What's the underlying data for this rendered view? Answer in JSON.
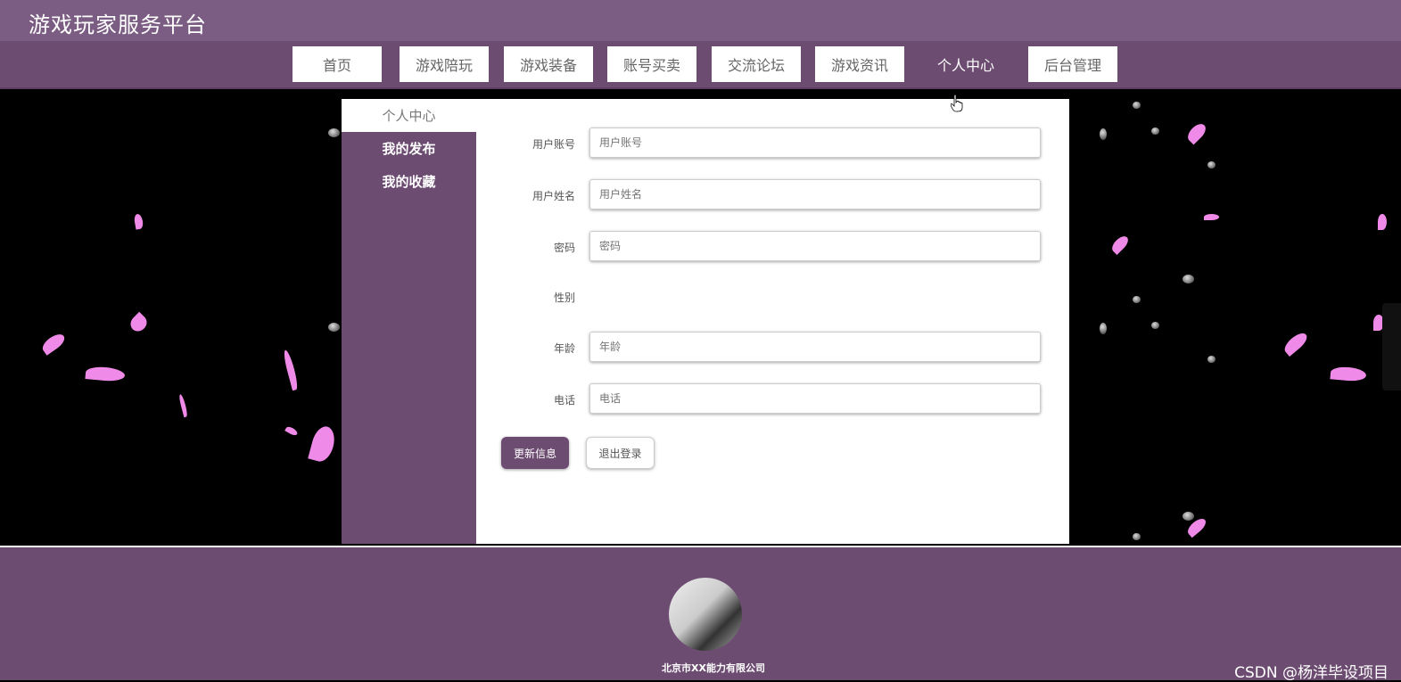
{
  "header": {
    "title": "游戏玩家服务平台"
  },
  "nav": {
    "items": [
      {
        "label": "首页"
      },
      {
        "label": "游戏陪玩"
      },
      {
        "label": "游戏装备"
      },
      {
        "label": "账号买卖"
      },
      {
        "label": "交流论坛"
      },
      {
        "label": "游戏资讯"
      },
      {
        "label": "个人中心"
      },
      {
        "label": "后台管理"
      }
    ],
    "active": "个人中心"
  },
  "sidebar": {
    "items": [
      {
        "label": "个人中心"
      },
      {
        "label": "我的发布"
      },
      {
        "label": "我的收藏"
      }
    ]
  },
  "form": {
    "account": {
      "label": "用户账号",
      "placeholder": "用户账号",
      "value": ""
    },
    "name": {
      "label": "用户姓名",
      "placeholder": "用户姓名",
      "value": ""
    },
    "password": {
      "label": "密码",
      "placeholder": "密码",
      "value": ""
    },
    "gender": {
      "label": "性别"
    },
    "age": {
      "label": "年龄",
      "placeholder": "年龄",
      "value": ""
    },
    "phone": {
      "label": "电话",
      "placeholder": "电话",
      "value": ""
    },
    "update_label": "更新信息",
    "logout_label": "退出登录"
  },
  "footer": {
    "company": "北京市XX能力有限公司",
    "watermark": "CSDN @杨洋毕设项目"
  },
  "colors": {
    "brand": "#6d4c72",
    "topbar": "#7b5c82",
    "petal": "#f08ae8"
  }
}
